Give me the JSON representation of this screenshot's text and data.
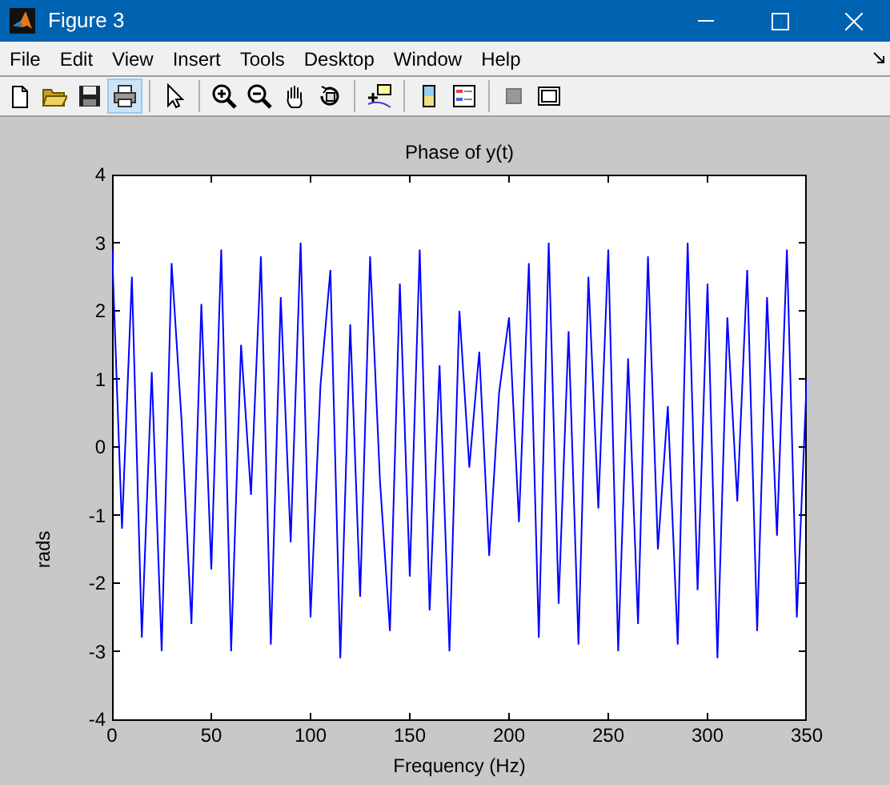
{
  "window": {
    "title": "Figure 3"
  },
  "menu": [
    "File",
    "Edit",
    "View",
    "Insert",
    "Tools",
    "Desktop",
    "Window",
    "Help"
  ],
  "toolbar_groups": [
    [
      {
        "pressed": false
      },
      {
        "pressed": false
      },
      {
        "pressed": false
      },
      {
        "pressed": true
      }
    ],
    [
      {
        "pressed": false
      }
    ],
    [
      {
        "pressed": false
      },
      {
        "pressed": false
      },
      {
        "pressed": false
      },
      {
        "pressed": false
      }
    ],
    [
      {
        "pressed": false
      }
    ],
    [
      {
        "pressed": false
      },
      {
        "pressed": false
      }
    ],
    [
      {
        "pressed": false
      },
      {
        "pressed": false
      }
    ]
  ],
  "plot": {
    "chart_data": {
      "type": "line",
      "title": "Phase of y(t)",
      "xlabel": "Frequency (Hz)",
      "ylabel": "rads",
      "xlim": [
        0,
        350
      ],
      "ylim": [
        -4,
        4
      ],
      "xticks": [
        0,
        50,
        100,
        150,
        200,
        250,
        300,
        350
      ],
      "yticks": [
        -4,
        -3,
        -2,
        -1,
        0,
        1,
        2,
        3,
        4
      ],
      "x": [
        0,
        5,
        10,
        15,
        20,
        25,
        30,
        35,
        40,
        45,
        50,
        55,
        60,
        65,
        70,
        75,
        80,
        85,
        90,
        95,
        100,
        105,
        110,
        115,
        120,
        125,
        130,
        135,
        140,
        145,
        150,
        155,
        160,
        165,
        170,
        175,
        180,
        185,
        190,
        195,
        200,
        205,
        210,
        215,
        220,
        225,
        230,
        235,
        240,
        245,
        250,
        255,
        260,
        265,
        270,
        275,
        280,
        285,
        290,
        295,
        300,
        305,
        310,
        315,
        320,
        325,
        330,
        335,
        340,
        345,
        350
      ],
      "series": [
        {
          "color": "#0000ff",
          "values": [
            2.9,
            -1.2,
            2.5,
            -2.8,
            1.1,
            -3.0,
            2.7,
            0.4,
            -2.6,
            2.1,
            -1.8,
            2.9,
            -3.0,
            1.5,
            -0.7,
            2.8,
            -2.9,
            2.2,
            -1.4,
            3.0,
            -2.5,
            0.9,
            2.6,
            -3.1,
            1.8,
            -2.2,
            2.8,
            -0.5,
            -2.7,
            2.4,
            -1.9,
            2.9,
            -2.4,
            1.2,
            -3.0,
            2.0,
            -0.3,
            1.4,
            -1.6,
            0.8,
            1.9,
            -1.1,
            2.7,
            -2.8,
            3.0,
            -2.3,
            1.7,
            -2.9,
            2.5,
            -0.9,
            2.9,
            -3.0,
            1.3,
            -2.6,
            2.8,
            -1.5,
            0.6,
            -2.9,
            3.0,
            -2.1,
            2.4,
            -3.1,
            1.9,
            -0.8,
            2.6,
            -2.7,
            2.2,
            -1.3,
            2.9,
            -2.5,
            1.0
          ]
        }
      ]
    }
  }
}
